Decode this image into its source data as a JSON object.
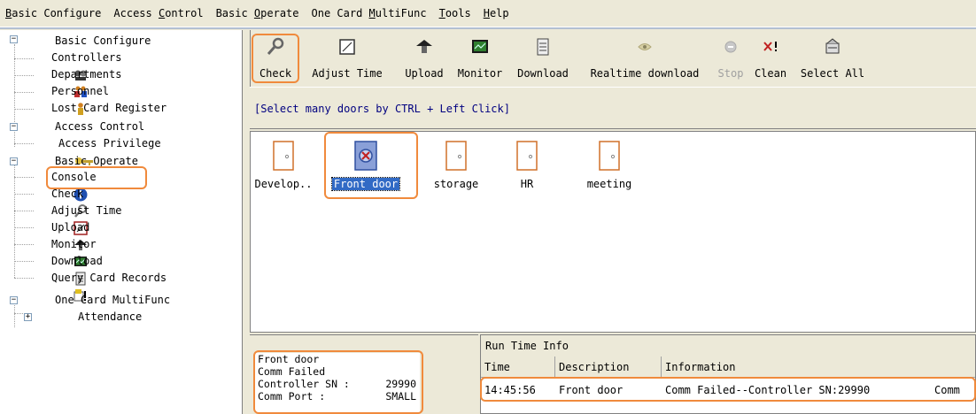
{
  "menu": [
    {
      "pre": "",
      "u": "B",
      "post": "asic Configure"
    },
    {
      "pre": "Access ",
      "u": "C",
      "post": "ontrol"
    },
    {
      "pre": "Basic ",
      "u": "O",
      "post": "perate"
    },
    {
      "pre": "One Card ",
      "u": "M",
      "post": "ultiFunc"
    },
    {
      "pre": "",
      "u": "T",
      "post": "ools"
    },
    {
      "pre": "",
      "u": "H",
      "post": "elp"
    }
  ],
  "tree": {
    "basic_configure": "Basic Configure",
    "controllers": "Controllers",
    "departments": "Departments",
    "personnel": "Personnel",
    "lost_card": "Lost Card Register",
    "access_control": "Access Control",
    "access_privilege": "Access Privilege",
    "basic_operate": "Basic Operate",
    "console": "Console",
    "check": "Check",
    "adjust_time": "Adjust Time",
    "upload": "Upload",
    "monitor": "Monitor",
    "download": "Download",
    "query_card": "Query Card Records",
    "one_card": "One Card MultiFunc",
    "attendance": "Attendance"
  },
  "toolbar": {
    "check": "Check",
    "adjust_time": "Adjust Time",
    "upload": "Upload",
    "monitor": "Monitor",
    "download": "Download",
    "realtime_download": "Realtime download",
    "stop": "Stop",
    "clean": "Clean",
    "select_all": "Select All"
  },
  "hint": "[Select many doors by CTRL + Left Click]",
  "doors": [
    {
      "label": "Develop..",
      "selected": false
    },
    {
      "label": "Front door",
      "selected": true
    },
    {
      "label": "storage",
      "selected": false
    },
    {
      "label": "HR",
      "selected": false
    },
    {
      "label": "meeting",
      "selected": false
    }
  ],
  "door_info": {
    "name": "Front door",
    "status": "Comm Failed",
    "sn_label": "Controller SN :",
    "sn_value": "29990",
    "port_label": "Comm Port :",
    "port_value": "SMALL"
  },
  "runtime": {
    "title": "Run Time Info",
    "col_time": "Time",
    "col_desc": "Description",
    "col_info": "Information",
    "row": {
      "time": "14:45:56",
      "desc": "Front door",
      "info": "Comm Failed--Controller SN:29990",
      "extra": "Comm"
    }
  },
  "colors": {
    "highlight": "#F08A3C",
    "selection": "#316AC5",
    "hint_text": "#000080"
  }
}
